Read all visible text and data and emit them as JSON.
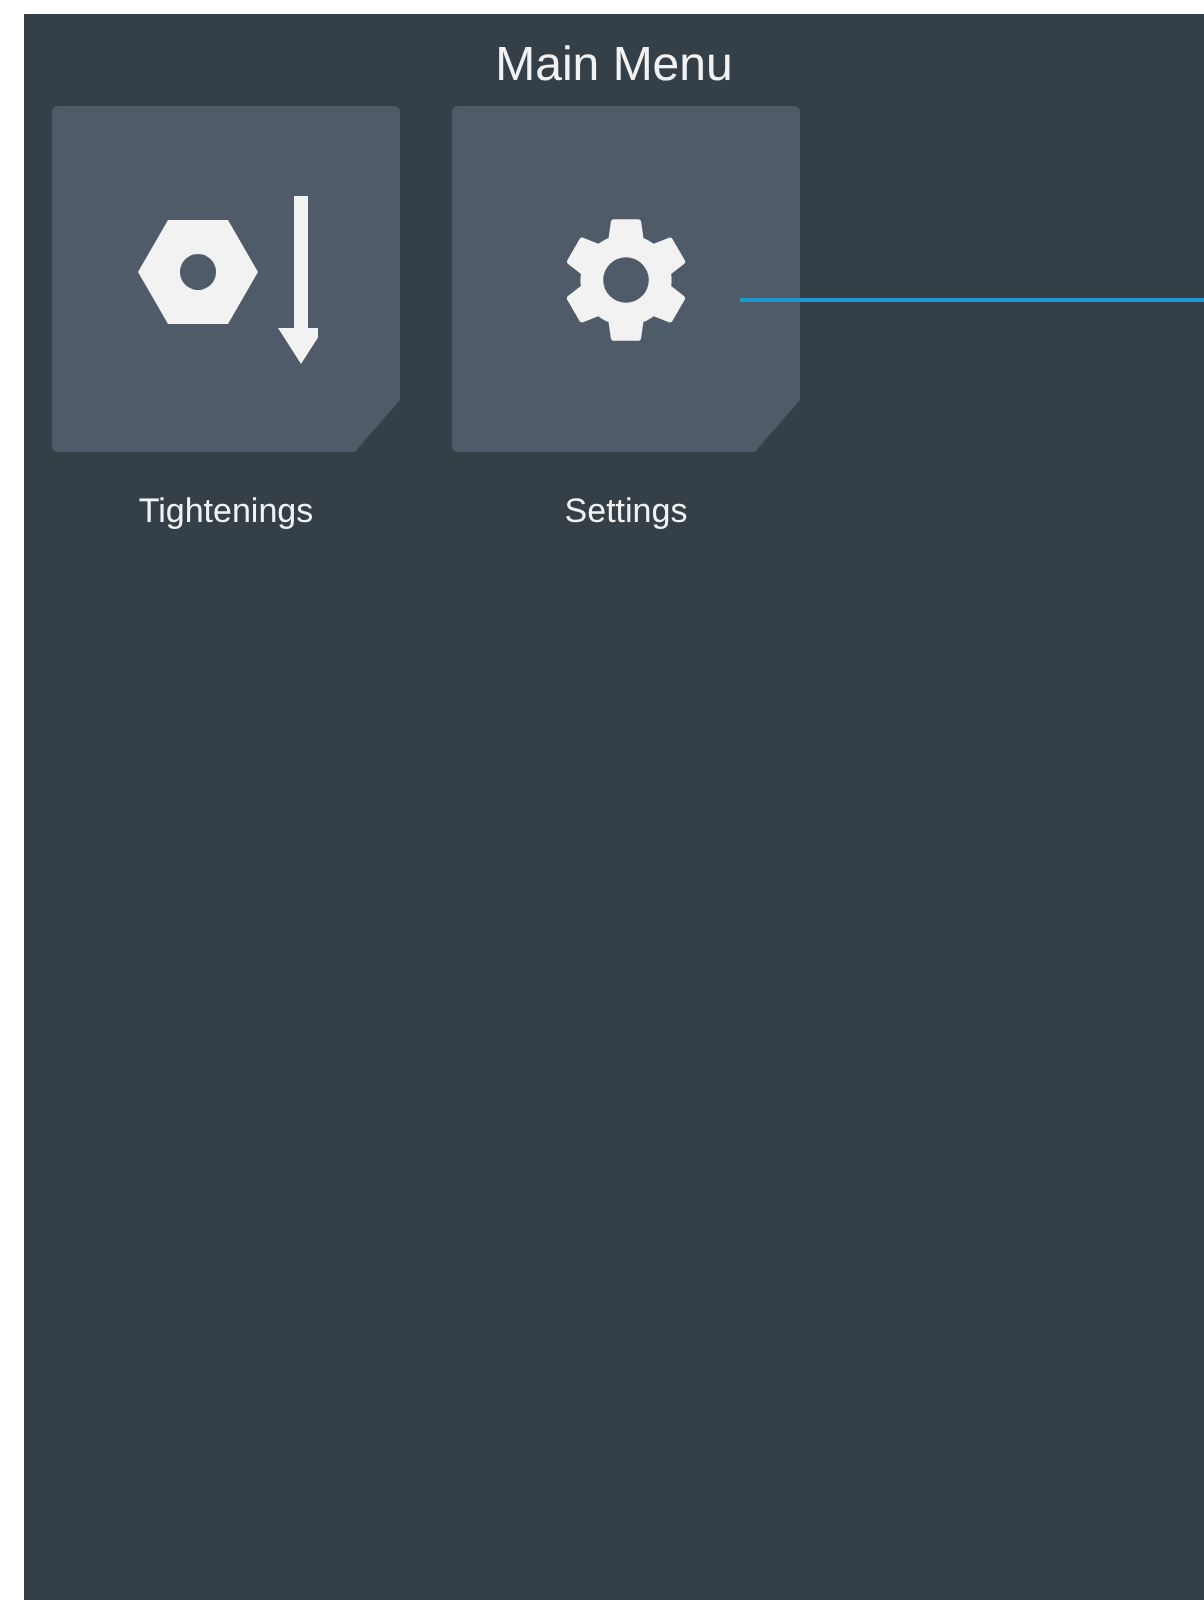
{
  "title": "Main Menu",
  "tiles": [
    {
      "label": "Tightenings",
      "kind": "tightening"
    },
    {
      "label": "Settings",
      "kind": "settings"
    }
  ]
}
